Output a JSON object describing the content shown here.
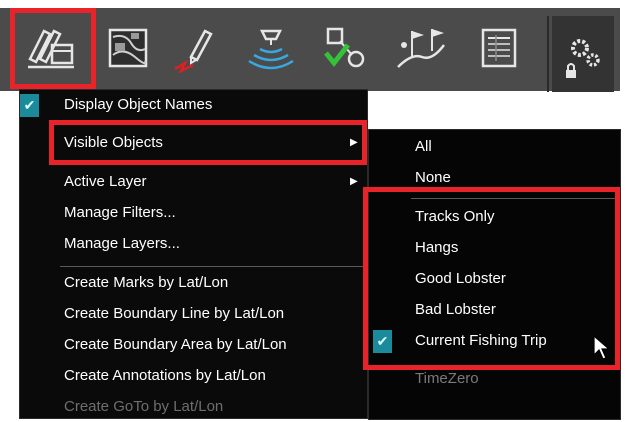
{
  "toolbar": {
    "buttons": [
      {
        "name": "edit-objects-icon"
      },
      {
        "name": "chart-overlay-icon"
      },
      {
        "name": "route-pencil-icon"
      },
      {
        "name": "sonar-icon"
      },
      {
        "name": "waypoint-goto-icon"
      },
      {
        "name": "marks-flags-icon"
      },
      {
        "name": "data-list-icon"
      }
    ],
    "settings_icon": "gear-lock-icon"
  },
  "main_menu": {
    "items": [
      {
        "label": "Display Object Names",
        "checked": true
      },
      {
        "label": "Visible Objects",
        "submenu": true
      },
      {
        "label": "Active Layer",
        "submenu": true
      },
      {
        "label": "Manage Filters..."
      },
      {
        "label": "Manage Layers..."
      },
      {
        "label": "Create Marks by Lat/Lon"
      },
      {
        "label": "Create Boundary Line by Lat/Lon"
      },
      {
        "label": "Create Boundary Area by Lat/Lon"
      },
      {
        "label": "Create Annotations by Lat/Lon"
      },
      {
        "label": "Create GoTo by Lat/Lon",
        "disabled": true
      }
    ],
    "submenu_arrow": "▶"
  },
  "sub_menu": {
    "items": [
      {
        "label": "All"
      },
      {
        "label": "None"
      },
      {
        "label": "Tracks Only"
      },
      {
        "label": "Hangs"
      },
      {
        "label": "Good Lobster"
      },
      {
        "label": "Bad Lobster"
      },
      {
        "label": "Current Fishing Trip",
        "checked": true
      },
      {
        "label": "TimeZero",
        "disabled": true
      }
    ]
  },
  "check_glyph": "✔",
  "colors": {
    "toolbar_bg": "#4b4b4b",
    "menu_bg": "#0a0a0a",
    "check_bg": "#1b8a9a",
    "highlight": "#e8232a",
    "menu_text": "#ffffff",
    "disabled_text": "#6e6e6e"
  }
}
